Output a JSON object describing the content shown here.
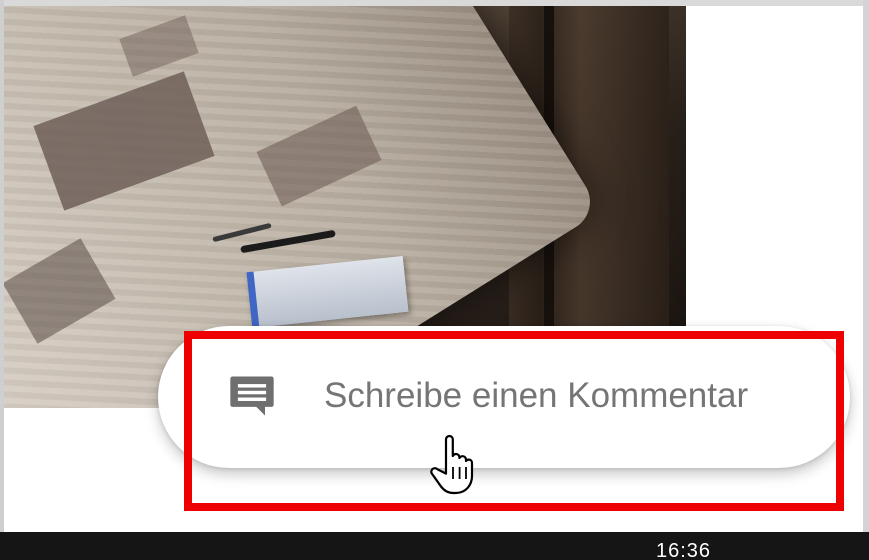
{
  "comment_box": {
    "placeholder": "Schreibe einen Kommentar",
    "icon": "comment-icon"
  },
  "status_bar": {
    "time": "16:36"
  },
  "colors": {
    "highlight": "#ee0000",
    "placeholder_text": "#757575",
    "icon": "#6f6f6f",
    "status_bar": "#151515"
  }
}
